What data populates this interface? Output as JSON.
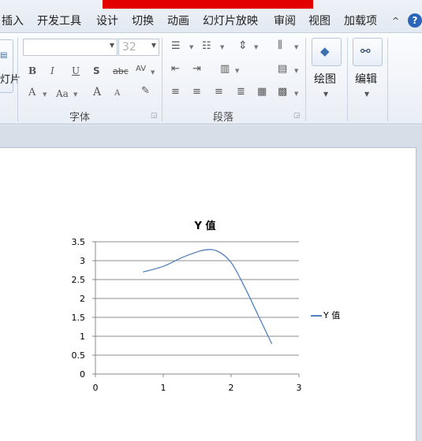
{
  "tabs": [
    "插入",
    "开发工具",
    "设计",
    "切换",
    "动画",
    "幻灯片放映",
    "审阅",
    "视图",
    "加载项"
  ],
  "help_label": "?",
  "collapse_label": "^",
  "ribbon": {
    "left_button_label": "灯片",
    "font_size_value": "32",
    "font_group_label": "字体",
    "paragraph_group_label": "段落",
    "drawing_label": "绘图",
    "editing_label": "编辑",
    "font_buttons": [
      "B",
      "I",
      "U",
      "S",
      "abc",
      "AV",
      "A",
      "Aa",
      "A",
      "A"
    ]
  },
  "chart_data": {
    "type": "line",
    "title": "Y 值",
    "series": [
      {
        "name": "Y 值",
        "color": "#4f81bd",
        "x": [
          0.7,
          1.0,
          1.3,
          1.6,
          1.8,
          2.0,
          2.2,
          2.4,
          2.6
        ],
        "y": [
          2.7,
          2.85,
          3.1,
          3.28,
          3.25,
          2.95,
          2.3,
          1.55,
          0.8
        ]
      }
    ],
    "x_ticks": [
      "0",
      "1",
      "2",
      "3"
    ],
    "y_ticks": [
      "0",
      "0.5",
      "1",
      "1.5",
      "2",
      "2.5",
      "3",
      "3.5"
    ],
    "xlim": [
      0,
      3
    ],
    "ylim": [
      0,
      3.5
    ],
    "grid": true,
    "legend_position": "right"
  }
}
